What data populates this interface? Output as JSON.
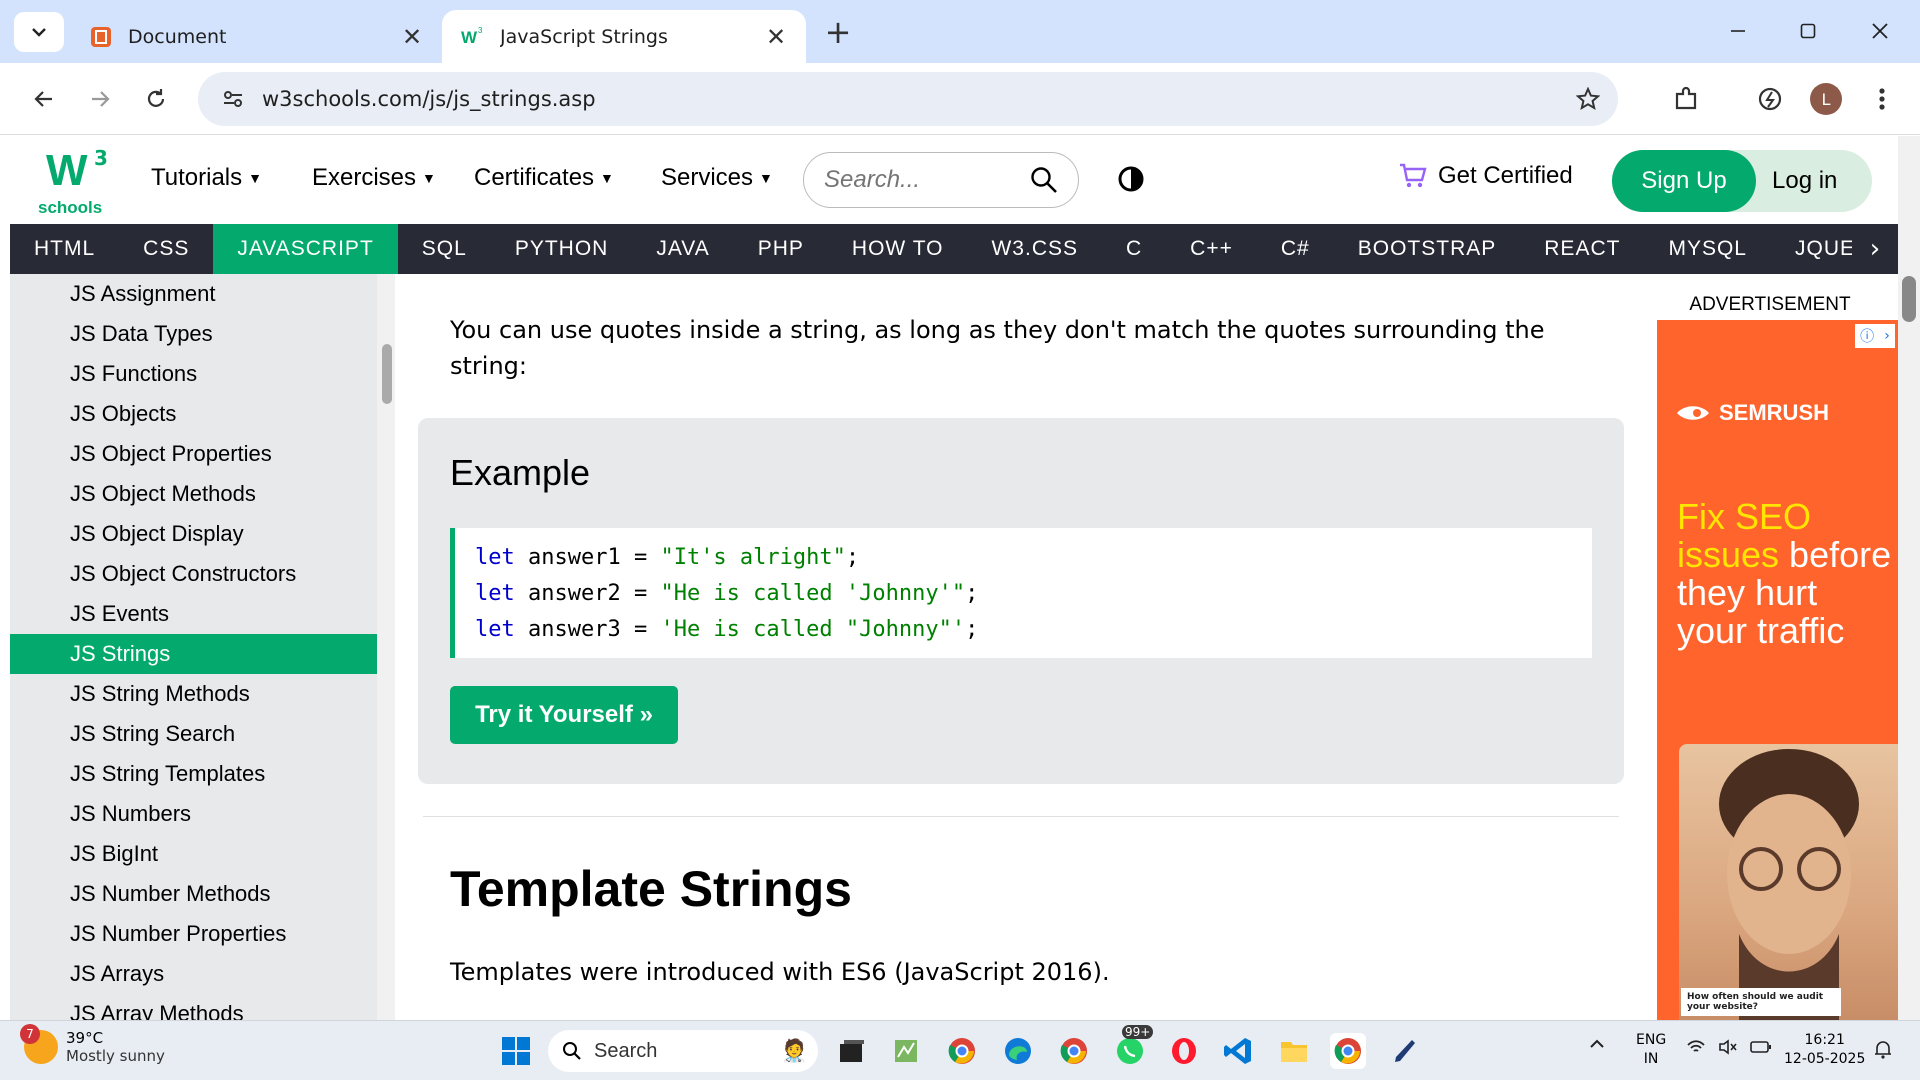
{
  "browser": {
    "tabs": [
      {
        "title": "Document",
        "active": false
      },
      {
        "title": "JavaScript Strings",
        "active": true
      }
    ],
    "url": "w3schools.com/js/js_strings.asp"
  },
  "header": {
    "logo_sup": "3",
    "logo_text": "schools",
    "menu": [
      "Tutorials",
      "Exercises",
      "Certificates",
      "Services"
    ],
    "search_placeholder": "Search...",
    "get_certified": "Get Certified",
    "sign_up": "Sign Up",
    "log_in": "Log in"
  },
  "topics": [
    "HTML",
    "CSS",
    "JAVASCRIPT",
    "SQL",
    "PYTHON",
    "JAVA",
    "PHP",
    "HOW TO",
    "W3.CSS",
    "C",
    "C++",
    "C#",
    "BOOTSTRAP",
    "REACT",
    "MYSQL",
    "JQUER"
  ],
  "active_topic": "JAVASCRIPT",
  "sidebar": {
    "items": [
      "JS Assignment",
      "JS Data Types",
      "JS Functions",
      "JS Objects",
      "JS Object Properties",
      "JS Object Methods",
      "JS Object Display",
      "JS Object Constructors",
      "JS Events",
      "JS Strings",
      "JS String Methods",
      "JS String Search",
      "JS String Templates",
      "JS Numbers",
      "JS BigInt",
      "JS Number Methods",
      "JS Number Properties",
      "JS Arrays",
      "JS Array Methods"
    ],
    "active": "JS Strings"
  },
  "main": {
    "intro": "You can use quotes inside a string, as long as they don't match the quotes surrounding the string:",
    "example_title": "Example",
    "code_lines": [
      {
        "kw": "let",
        "var": " answer1 = ",
        "str": "\"It's alright\"",
        "end": ";"
      },
      {
        "kw": "let",
        "var": " answer2 = ",
        "str": "\"He is called 'Johnny'\"",
        "end": ";"
      },
      {
        "kw": "let",
        "var": " answer3 = ",
        "str": "'He is called \"Johnny\"'",
        "end": ";"
      }
    ],
    "try_button": "Try it Yourself »",
    "section_title": "Template Strings",
    "section_text": "Templates were introduced with ES6 (JavaScript 2016)."
  },
  "ad": {
    "label": "ADVERTISEMENT",
    "brand": "SEMRUSH",
    "headline_highlight": "Fix SEO issues",
    "headline_rest": " before they hurt your traffic",
    "caption": "How often should we audit your website?"
  },
  "taskbar": {
    "weather_badge": "7",
    "temperature": "39°C",
    "weather_desc": "Mostly sunny",
    "search": "Search",
    "whatsapp_badge": "99+",
    "lang1": "ENG",
    "lang2": "IN",
    "time": "16:21",
    "date": "12-05-2025"
  },
  "colors": {
    "accent": "#04aa6d",
    "topic_bar": "#282a35",
    "sidebar_bg": "#e7e9eb",
    "ad_bg": "#ff642d"
  }
}
